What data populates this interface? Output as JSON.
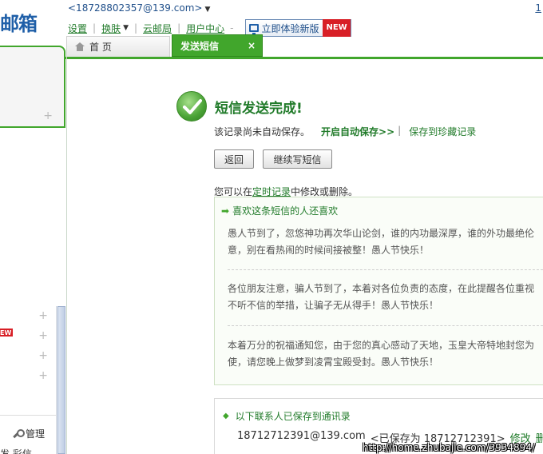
{
  "app": {
    "logo_text": "邮箱",
    "account": "<18728802357@139.com>",
    "top_right_digit": "1"
  },
  "topnav": {
    "settings": "设置",
    "skin": "换肤",
    "cloud_post": "云邮局",
    "user_center": "用户中心",
    "try_new": "立即体验新版",
    "new_tag": "NEW"
  },
  "tabs": {
    "home": "首 页",
    "send_sms": "发送短信",
    "close": "×"
  },
  "left": {
    "new_badge": "EW",
    "manage": "管理",
    "bottom_text": "发 彩信"
  },
  "main": {
    "success_title": "短信发送完成!",
    "not_saved": "该记录尚未自动保存。",
    "enable_autosave": "开启自动保存>>",
    "bar": "|",
    "save_to_collection": "保存到珍藏记录",
    "back_button": "返回",
    "continue_button": "继续写短信",
    "edit_note_before": "您可以在",
    "edit_note_link": "定时记录",
    "edit_note_after": "中修改或删除。"
  },
  "recommend": {
    "title": "喜欢这条短信的人还喜欢",
    "items": [
      {
        "line1": "愚人节到了，忽悠神功再次华山论剑，谁的内功最深厚，谁的外功最绝伦",
        "line2": "意，别在看热闹的时候间接被整！愚人节快乐！"
      },
      {
        "line1": "各位朋友注意，骗人节到了，本着对各位负责的态度，在此提醒各位重视",
        "line2": "不听不信的举措，让骗子无从得手！愚人节快乐！"
      },
      {
        "line1": "本着万分的祝福通知您，由于您的真心感动了天地，玉皇大帝特地封您为",
        "line2": "使，请您晚上做梦到凌霄宝殿受封。愚人节快乐！"
      }
    ]
  },
  "contacts": {
    "title": "以下联系人已保存到通讯录",
    "address": "18712712391@139.com",
    "saved_as": "<已保存为 18712712391>",
    "edit": "修改",
    "delete": "删除"
  },
  "watermark": "http://home.zhubajie.com/3934894/"
}
